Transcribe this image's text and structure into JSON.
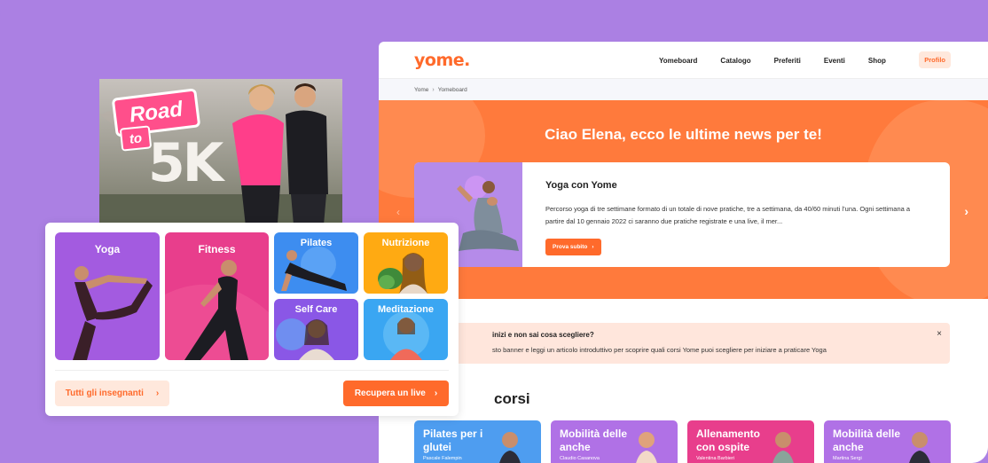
{
  "site": {
    "logo": "yome.",
    "nav": [
      "Yomeboard",
      "Catalogo",
      "Preferiti",
      "Eventi",
      "Shop"
    ],
    "profile_label": "Profilo"
  },
  "breadcrumb": {
    "home": "Yome",
    "separator": "›",
    "current": "Yomeboard"
  },
  "hero": {
    "title": "Ciao Elena, ecco le ultime news per te!",
    "arrow_left": "‹",
    "arrow_right": "›",
    "card": {
      "title": "Yoga con Yome",
      "text": "Percorso yoga di tre settimane formato di un totale di nove pratiche, tre a settimana, da 40/60 minuti l’una. Ogni settimana a partire dal 10 gennaio 2022 ci saranno due pratiche registrate e una live, il mer...",
      "button": "Prova subito",
      "button_chevron": "›"
    }
  },
  "notice": {
    "title": "inizi e non sai cosa scegliere?",
    "text": "sto banner e leggi un articolo introduttivo per scoprire quali corsi Yome puoi scegliere per iniziare a praticare Yoga",
    "close": "×"
  },
  "courses_section": {
    "title": "corsi",
    "items": [
      {
        "title": "Pilates per i glutei",
        "teacher": "Pascale Falempin",
        "color": "#4e9df0"
      },
      {
        "title": "Mobilità delle anche",
        "teacher": "Claudio Casanova",
        "color": "#b071e6"
      },
      {
        "title": "Allenamento con ospite",
        "teacher": "Valentina Barbieri",
        "color": "#e83e8c"
      },
      {
        "title": "Mobilità delle anche",
        "teacher": "Martina Sergi",
        "color": "#b071e6"
      }
    ]
  },
  "promo": {
    "road": "Road",
    "to": "to",
    "fivek": "5K"
  },
  "categories": {
    "tiles": [
      {
        "label": "Yoga",
        "color": "#a35be0"
      },
      {
        "label": "Fitness",
        "color": "#e83e8c"
      },
      {
        "label": "Pilates",
        "color": "#3d8df0"
      },
      {
        "label": "Nutrizione",
        "color": "#ffaa12"
      },
      {
        "label": "Self Care",
        "color": "#8a57e6"
      },
      {
        "label": "Meditazione",
        "color": "#3aa6f2"
      }
    ],
    "teachers_button": "Tutti gli insegnanti",
    "live_button": "Recupera un live",
    "chevron": "›"
  },
  "colors": {
    "accent": "#ff6a2b",
    "background": "#ab80e3",
    "hero": "#ff7a3c"
  }
}
